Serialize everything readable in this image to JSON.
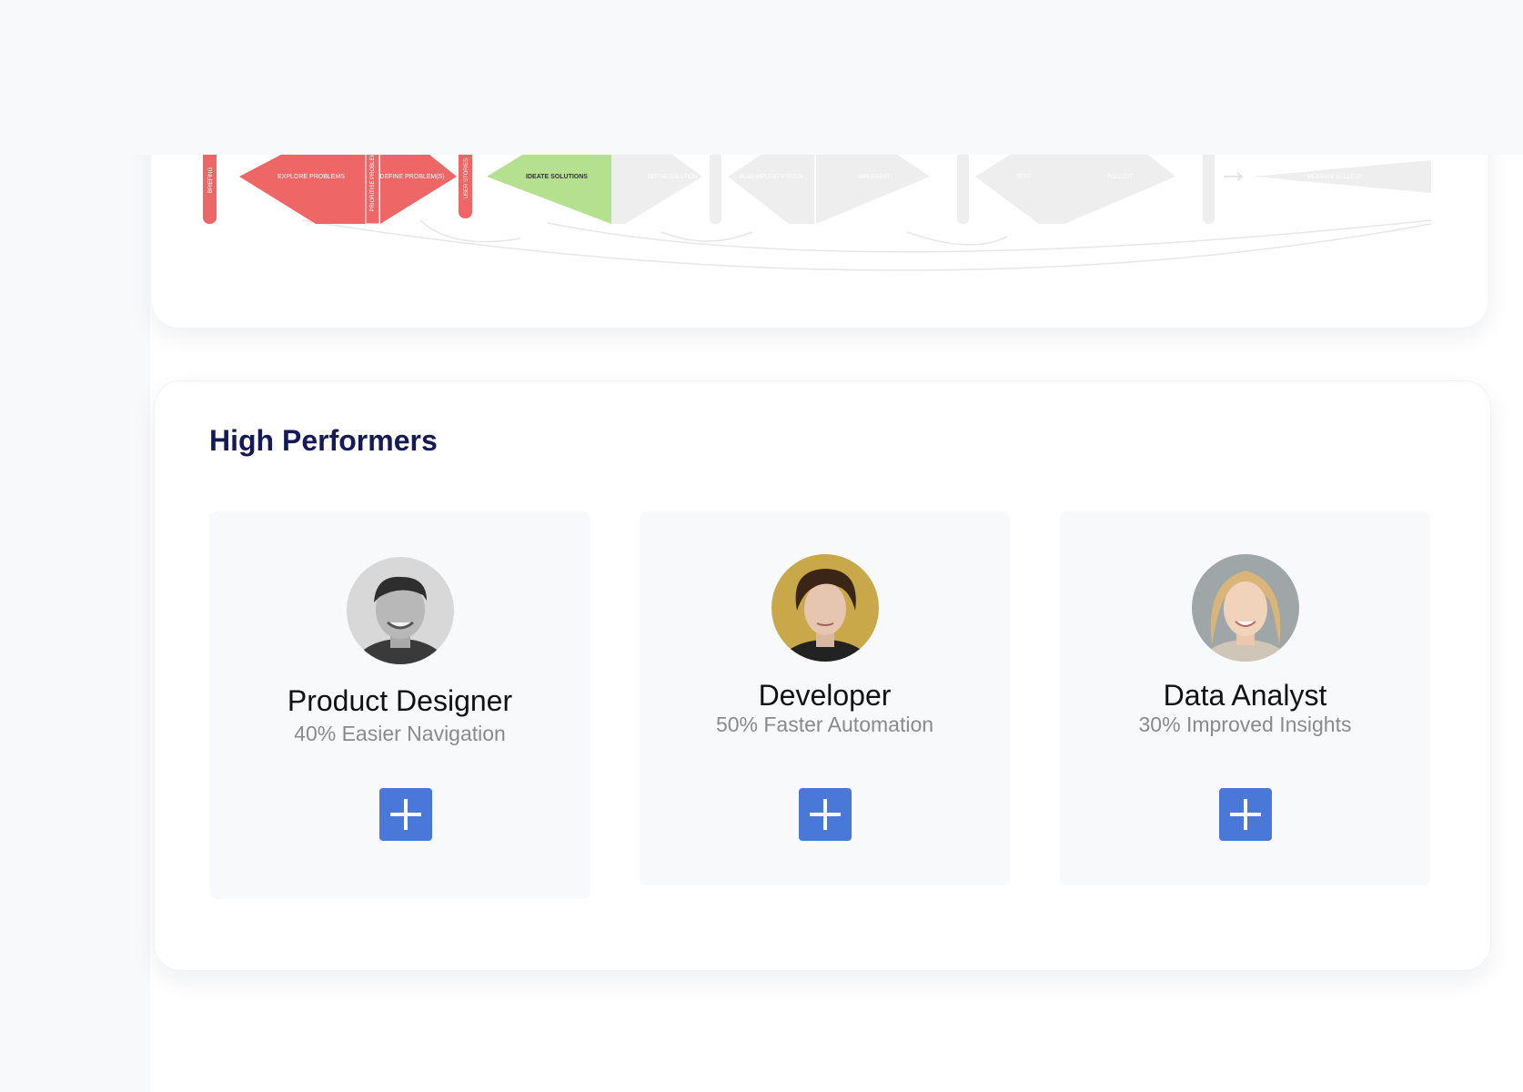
{
  "theme": {
    "accent": "#4a78d8",
    "title_color": "#161a54",
    "process_active_red": "#ee6666",
    "process_active_green": "#b5e090",
    "process_inactive": "#eeeeee"
  },
  "process": {
    "stages": [
      {
        "label": "BRIEFING",
        "status": "done"
      },
      {
        "label": "EXPLORE PROBLEMS",
        "status": "done"
      },
      {
        "label": "PRIORITISE PROBLEMS",
        "status": "done"
      },
      {
        "label": "DEFINE PROBLEM(S)",
        "status": "done"
      },
      {
        "label": "USER STORIES",
        "status": "done"
      },
      {
        "label": "IDEATE SOLUTIONS",
        "status": "current"
      },
      {
        "label": "DEFINE SOLUTION",
        "status": "pending"
      },
      {
        "label": "PLAN IMPLEMENTATION",
        "status": "pending"
      },
      {
        "label": "IMPLEMENT",
        "status": "pending"
      },
      {
        "label": "TEST",
        "status": "pending"
      },
      {
        "label": "ROLLOUT",
        "status": "pending"
      },
      {
        "label": "MEASURE SUCCESS",
        "status": "pending"
      }
    ]
  },
  "high_performers": {
    "title": "High Performers",
    "items": [
      {
        "role": "Product Designer",
        "stat": "40% Easier Navigation",
        "add_icon": "plus-icon"
      },
      {
        "role": "Developer",
        "stat": "50% Faster Automation",
        "add_icon": "plus-icon"
      },
      {
        "role": "Data Analyst",
        "stat": "30% Improved Insights",
        "add_icon": "plus-icon"
      }
    ]
  }
}
